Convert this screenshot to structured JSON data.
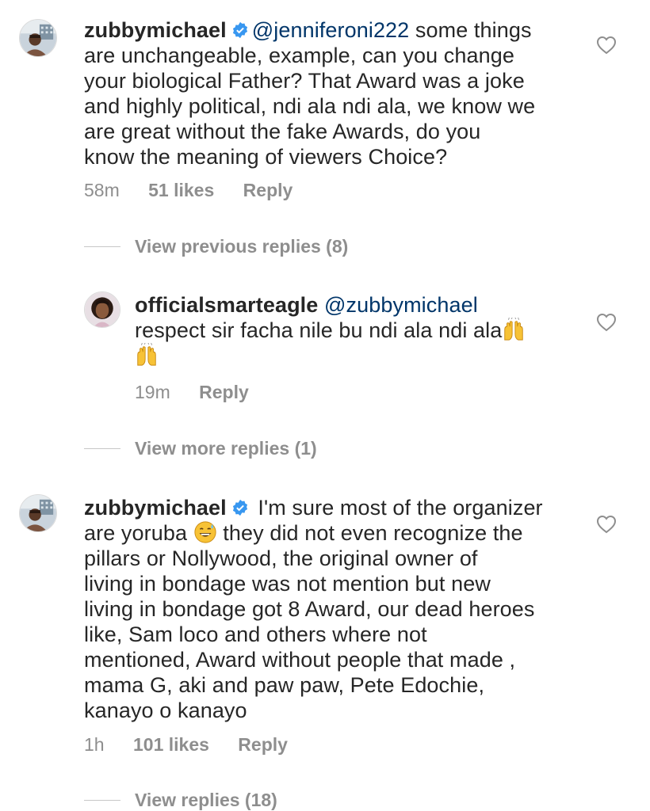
{
  "comments": [
    {
      "username": "zubbymichael",
      "verified": true,
      "mention": "@jenniferoni222",
      "lines": [
        " some things",
        "are unchangeable, example, can you change",
        "your biological Father? That Award was a joke",
        "and highly political, ndi ala ndi ala, we know we",
        "are great without the fake Awards, do you",
        "know the meaning of viewers Choice?"
      ],
      "time": "58m",
      "likes": "51 likes",
      "reply": "Reply",
      "avatar_icon": "profile-photo"
    },
    {
      "username": "officialsmarteagle",
      "mention": "@zubbymichael",
      "line2": "respect sir facha nile bu ndi ala ndi ala",
      "emoji_name": "raising-hands-emoji",
      "time": "19m",
      "reply": "Reply",
      "avatar_icon": "profile-photo"
    },
    {
      "username": "zubbymichael",
      "verified": true,
      "line1": " I'm sure most of the organizer",
      "line2a": "are yoruba ",
      "emoji_name": "grinning-sweat-emoji",
      "line2b": " they did not even recognize the",
      "lines": [
        "pillars or Nollywood,  the original owner of",
        "living in bondage was not mention  but new",
        "living in bondage got 8 Award, our dead heroes",
        "like,  Sam loco and others where not",
        "mentioned, Award without people that made ,",
        "mama G, aki and paw paw, Pete Edochie,",
        "kanayo o kanayo"
      ],
      "time": "1h",
      "likes": "101 likes",
      "reply": "Reply",
      "avatar_icon": "profile-photo"
    }
  ],
  "view_previous": "View previous replies (8)",
  "view_more": "View more replies (1)",
  "view_replies": "View replies (18)",
  "colors": {
    "text": "#262626",
    "secondary": "#8e8e8e",
    "mention": "#003569",
    "verified": "#3897f0"
  }
}
